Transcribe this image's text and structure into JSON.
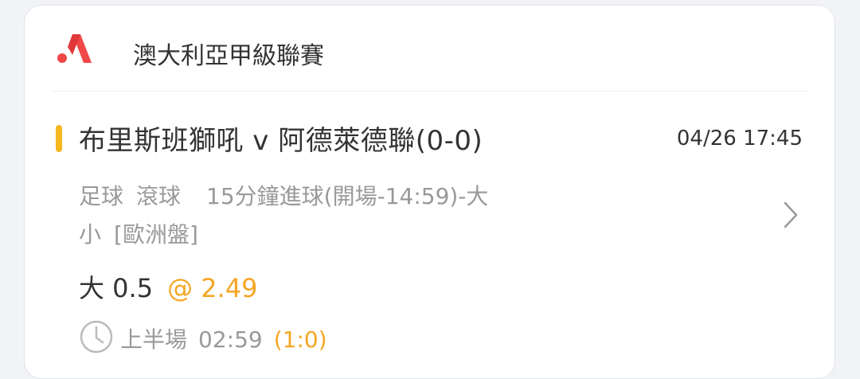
{
  "league": {
    "name": "澳大利亞甲級聯賽",
    "logo_icon": "league-logo-icon",
    "logo_color": "#f04848"
  },
  "match": {
    "title": "布里斯班獅吼 v 阿德萊德聯(0-0)",
    "datetime": "04/26 17:45"
  },
  "market": {
    "line1_sport": "足球",
    "line1_type": "滾球",
    "line1_market": "15分鐘進球(開場-14:59)-大",
    "line2_market": "小",
    "line2_odds_type": "[歐洲盤]"
  },
  "selection": {
    "label": "大 0.5",
    "odds": "@ 2.49"
  },
  "status": {
    "period": "上半場",
    "clock": "02:59",
    "score": "(1:0)"
  },
  "colors": {
    "accent": "#f5b81e",
    "odds": "#f5a623",
    "primary_text": "#333333",
    "secondary_text": "#999999"
  }
}
